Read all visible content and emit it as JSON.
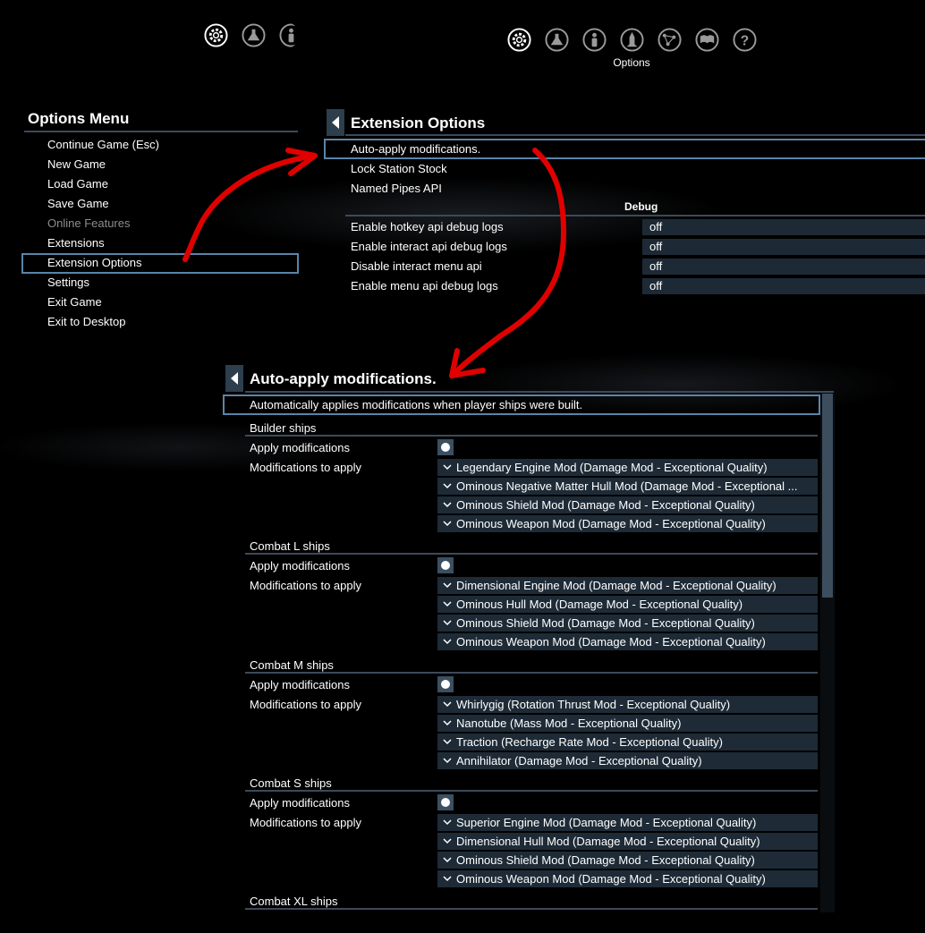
{
  "top_bar_small": {
    "icons": [
      "gear-icon",
      "flask-icon",
      "person-icon"
    ]
  },
  "top_bar": {
    "icons": [
      "gear-icon",
      "flask-icon",
      "person-icon",
      "ship-icon",
      "map-icon",
      "book-icon",
      "help-icon"
    ],
    "label": "Options"
  },
  "options_menu": {
    "title": "Options Menu",
    "items": [
      {
        "label": "Continue Game (Esc)"
      },
      {
        "label": "New Game"
      },
      {
        "label": "Load Game"
      },
      {
        "label": "Save Game"
      },
      {
        "label": "Online Features",
        "disabled": true
      },
      {
        "label": "Extensions"
      },
      {
        "label": "Extension Options",
        "selected": true
      },
      {
        "label": "Settings"
      },
      {
        "label": "Exit Game"
      },
      {
        "label": "Exit to Desktop"
      }
    ]
  },
  "extension_options": {
    "title": "Extension Options",
    "items": [
      "Auto-apply modifications.",
      "Lock Station Stock",
      "Named Pipes API"
    ],
    "debug_header": "Debug",
    "debug": [
      {
        "label": "Enable hotkey api debug logs",
        "value": "off"
      },
      {
        "label": "Enable interact api debug logs",
        "value": "off"
      },
      {
        "label": "Disable interact menu api",
        "value": "off"
      },
      {
        "label": "Enable menu api debug logs",
        "value": "off"
      }
    ]
  },
  "auto_apply": {
    "title": "Auto-apply modifications.",
    "description": "Automatically applies modifications when player ships were built.",
    "apply_label": "Apply modifications",
    "mods_label": "Modifications to apply",
    "sections": [
      {
        "name": "Builder ships",
        "mods": [
          "Legendary Engine Mod (Damage Mod - Exceptional Quality)",
          "Ominous Negative Matter Hull Mod (Damage Mod - Exceptional ...",
          "Ominous Shield Mod (Damage Mod - Exceptional Quality)",
          "Ominous Weapon Mod (Damage Mod - Exceptional Quality)"
        ]
      },
      {
        "name": "Combat L ships",
        "mods": [
          "Dimensional Engine Mod (Damage Mod - Exceptional Quality)",
          "Ominous Hull Mod (Damage Mod - Exceptional Quality)",
          "Ominous Shield Mod (Damage Mod - Exceptional Quality)",
          "Ominous Weapon Mod (Damage Mod - Exceptional Quality)"
        ]
      },
      {
        "name": "Combat M ships",
        "mods": [
          "Whirlygig (Rotation Thrust Mod - Exceptional Quality)",
          "Nanotube (Mass Mod - Exceptional Quality)",
          "Traction (Recharge Rate Mod - Exceptional Quality)",
          "Annihilator (Damage Mod - Exceptional Quality)"
        ]
      },
      {
        "name": "Combat S ships",
        "mods": [
          "Superior Engine Mod (Damage Mod - Exceptional Quality)",
          "Dimensional Hull Mod (Damage Mod - Exceptional Quality)",
          "Ominous Shield Mod (Damage Mod - Exceptional Quality)",
          "Ominous Weapon Mod (Damage Mod - Exceptional Quality)"
        ]
      },
      {
        "name": "Combat XL ships",
        "mods": []
      }
    ]
  },
  "colors": {
    "background": "#000000",
    "selection_border": "#5a84a8",
    "divider": "#3c4a5a",
    "field_bg": "#1e2b37",
    "annotation_arrow": "#e00000"
  }
}
